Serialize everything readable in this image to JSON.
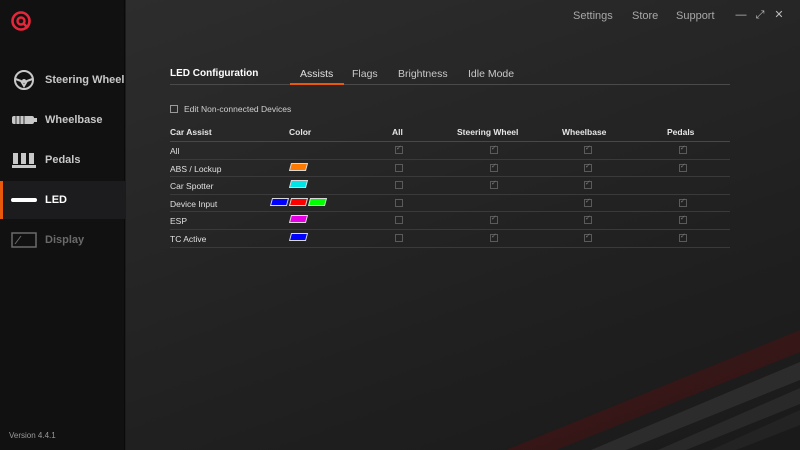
{
  "app": {
    "version": "Version 4.4.1"
  },
  "sidebar": {
    "items": [
      {
        "label": "Steering Wheel",
        "icon": "steering-wheel-icon",
        "state": "normal"
      },
      {
        "label": "Wheelbase",
        "icon": "wheelbase-icon",
        "state": "normal"
      },
      {
        "label": "Pedals",
        "icon": "pedals-icon",
        "state": "normal"
      },
      {
        "label": "LED",
        "icon": "led-icon",
        "state": "active"
      },
      {
        "label": "Display",
        "icon": "display-icon",
        "state": "disabled"
      }
    ]
  },
  "topbar": {
    "settings": "Settings",
    "store": "Store",
    "support": "Support",
    "minimize": "—",
    "maximize": "⤢",
    "close": "✕"
  },
  "led": {
    "title": "LED Configuration",
    "tabs": [
      {
        "label": "Assists",
        "active": true
      },
      {
        "label": "Flags",
        "active": false
      },
      {
        "label": "Brightness",
        "active": false
      },
      {
        "label": "Idle Mode",
        "active": false
      }
    ],
    "edit_non_connected": {
      "label": "Edit Non-connected Devices",
      "checked": false
    },
    "table": {
      "headers": {
        "car_assist": "Car Assist",
        "color": "Color",
        "all": "All",
        "steering_wheel": "Steering Wheel",
        "wheelbase": "Wheelbase",
        "pedals": "Pedals"
      },
      "rows": [
        {
          "name": "All",
          "colors": [],
          "all": true,
          "steering_wheel": true,
          "wheelbase": true,
          "pedals": true
        },
        {
          "name": "ABS / Lockup",
          "colors": [
            "#ff7a00"
          ],
          "all": false,
          "steering_wheel": true,
          "wheelbase": true,
          "pedals": true
        },
        {
          "name": "Car Spotter",
          "colors": [
            "#00e5e5"
          ],
          "all": false,
          "steering_wheel": true,
          "wheelbase": true,
          "pedals": null
        },
        {
          "name": "Device Input",
          "colors": [
            "#0000ff",
            "#ff0000",
            "#00ff00"
          ],
          "all": false,
          "steering_wheel": null,
          "wheelbase": true,
          "pedals": true
        },
        {
          "name": "ESP",
          "colors": [
            "#e600e6"
          ],
          "all": false,
          "steering_wheel": true,
          "wheelbase": true,
          "pedals": true
        },
        {
          "name": "TC Active",
          "colors": [
            "#0000ff"
          ],
          "all": false,
          "steering_wheel": true,
          "wheelbase": true,
          "pedals": true
        }
      ]
    }
  },
  "colors": {
    "accent": "#e8590c",
    "logo": "#e8263a"
  }
}
